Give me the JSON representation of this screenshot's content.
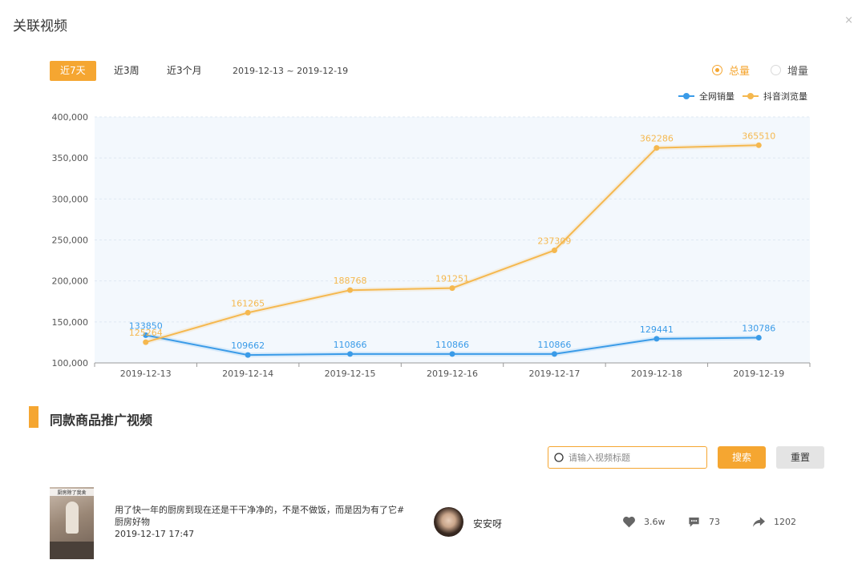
{
  "modal": {
    "title": "关联视频",
    "close_symbol": "×"
  },
  "range_tabs": [
    {
      "label": "近7天",
      "active": true
    },
    {
      "label": "近3周",
      "active": false
    },
    {
      "label": "近3个月",
      "active": false
    }
  ],
  "date_range": "2019-12-13 ~ 2019-12-19",
  "mode_radios": [
    {
      "label": "总量",
      "checked": true
    },
    {
      "label": "增量",
      "checked": false
    }
  ],
  "colors": {
    "accent": "#f5a631",
    "series_blue": "#3a9be8",
    "series_orange": "#f5b84f",
    "plot_bg": "#f3f8fd"
  },
  "chart_data": {
    "type": "line",
    "x": [
      "2019-12-13",
      "2019-12-14",
      "2019-12-15",
      "2019-12-16",
      "2019-12-17",
      "2019-12-18",
      "2019-12-19"
    ],
    "series": [
      {
        "name": "全网销量",
        "color": "#3a9be8",
        "values": [
          133850,
          109662,
          110866,
          110866,
          110866,
          129441,
          130786
        ]
      },
      {
        "name": "抖音浏览量",
        "color": "#f5b84f",
        "values": [
          125264,
          161265,
          188768,
          191251,
          237309,
          362286,
          365510
        ]
      }
    ],
    "ylim": [
      100000,
      400000
    ],
    "yticks": [
      "100,000",
      "150,000",
      "200,000",
      "250,000",
      "300,000",
      "350,000",
      "400,000"
    ],
    "ytick_values": [
      100000,
      150000,
      200000,
      250000,
      300000,
      350000,
      400000
    ],
    "legend_position": "top-right",
    "data_labels": true,
    "grid": true
  },
  "section": {
    "title": "同款商品推广视频"
  },
  "search": {
    "placeholder": "请输入视频标题",
    "value": "",
    "search_label": "搜索",
    "reset_label": "重置"
  },
  "videos": [
    {
      "thumb_caption": "厨房除了我舍",
      "title": "用了快一年的厨房到现在还是干干净净的，不是不做饭，而是因为有了它#厨房好物",
      "time": "2019-12-17 17:47",
      "author": "安安呀",
      "likes": "3.6w",
      "comments": "73",
      "shares": "1202"
    }
  ]
}
